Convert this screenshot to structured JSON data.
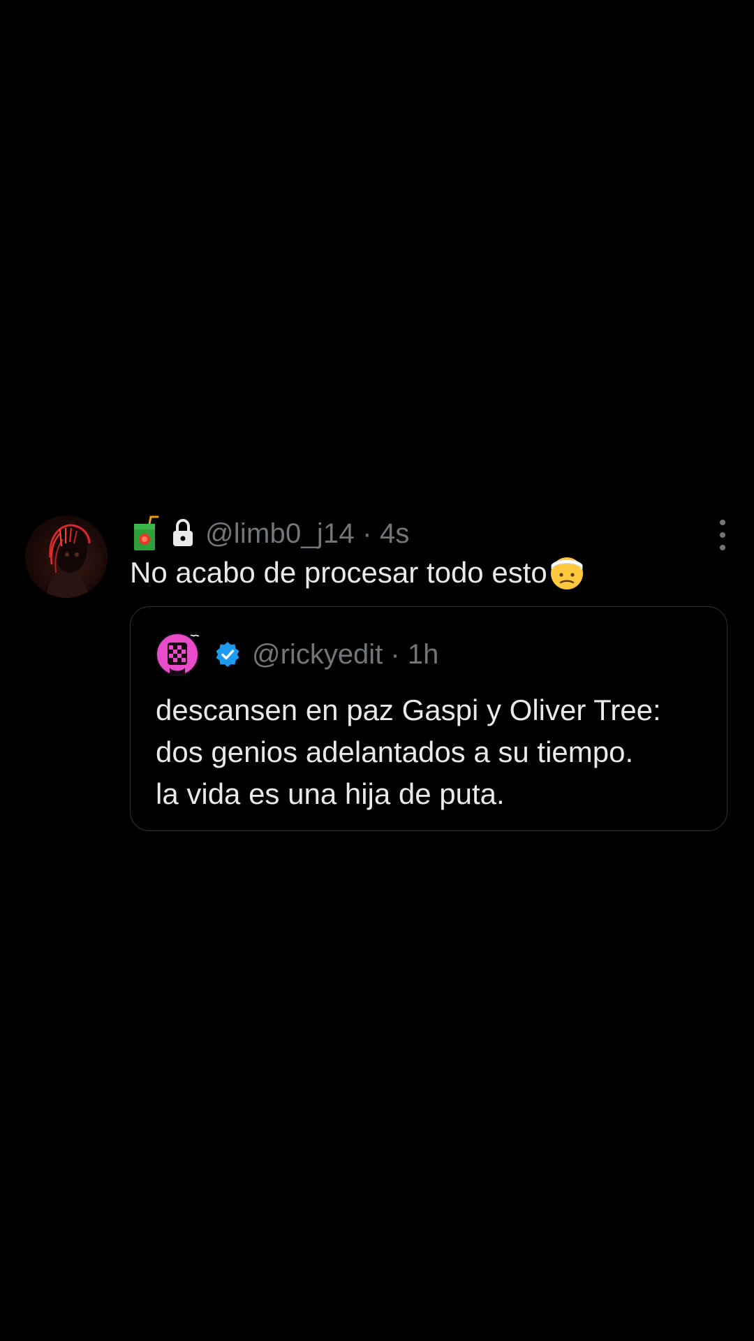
{
  "tweet": {
    "handle_line": "@limb0_j14 · 4s",
    "text": "No acabo de procesar todo esto",
    "avatar_icon": "red-neon-portrait-avatar",
    "badge_icon": "juice-box-emoji-icon",
    "lock_icon": "lock-icon",
    "reaction_icon": "head-bandage-face-emoji-icon",
    "menu_icon": "vertical-dots-icon"
  },
  "quote": {
    "handle_line": "@rickyedit · 1h",
    "lines": [
      "descansen en paz Gaspi y Oliver Tree:",
      "dos genios adelantados a su tiempo.",
      "la vida es una hija de puta."
    ],
    "avatar_icon": "pink-checker-avatar",
    "verified_icon": "verified-badge-icon",
    "verified_color": "#1d9bf0"
  },
  "colors": {
    "background": "#000000",
    "text_primary": "#e7e9ea",
    "text_secondary": "#71767b",
    "border": "#2f3336"
  }
}
